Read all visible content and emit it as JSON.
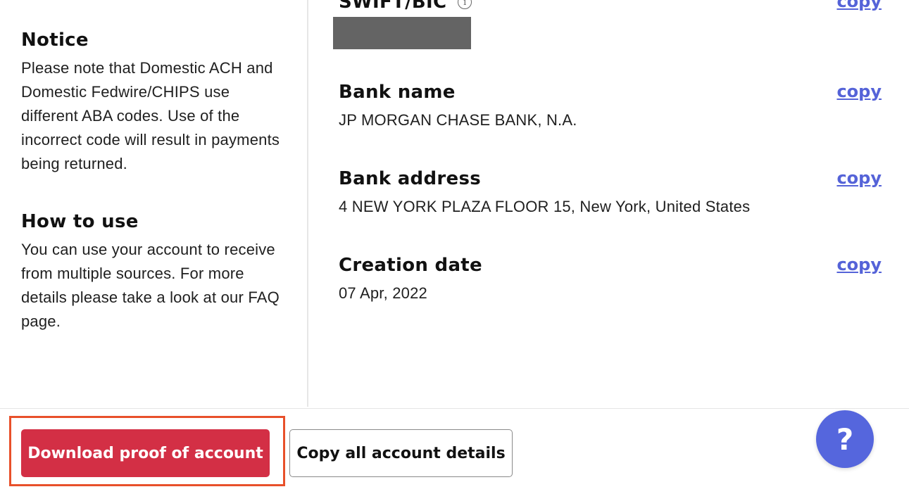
{
  "notice": {
    "title": "Notice",
    "body": "Please note that Domestic ACH and Domestic Fedwire/CHIPS use different ABA codes. Use of the incorrect code will result in payments being returned."
  },
  "how_to_use": {
    "title": "How to use",
    "body": "You can use your account to receive from multiple sources. For more details please take a look at our FAQ page."
  },
  "fields": {
    "swift": {
      "label": "SWIFT/BIC",
      "info_icon": "info-icon",
      "value_redacted": true,
      "copy_label": "copy"
    },
    "bank_name": {
      "label": "Bank name",
      "value": "JP MORGAN CHASE BANK, N.A.",
      "copy_label": "copy"
    },
    "bank_address": {
      "label": "Bank address",
      "value": "4 NEW YORK PLAZA FLOOR 15, New York, United States",
      "copy_label": "copy"
    },
    "creation_date": {
      "label": "Creation date",
      "value": "07 Apr, 2022",
      "copy_label": "copy"
    }
  },
  "footer": {
    "download_label": "Download proof of account",
    "copy_all_label": "Copy all account details",
    "help_label": "?"
  },
  "colors": {
    "primary_red": "#d32f45",
    "link_blue": "#5563d8",
    "help_blue": "#5566dd",
    "highlight_orange": "#e8502a",
    "redaction_gray": "#646464"
  }
}
